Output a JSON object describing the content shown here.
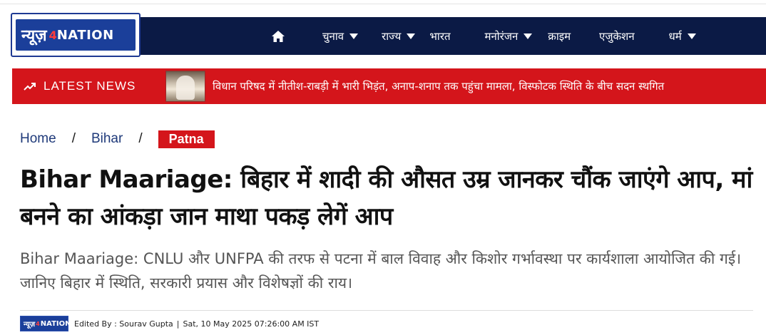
{
  "logo": {
    "hindi": "न्यूज़",
    "number": "4",
    "english": "NATION"
  },
  "nav": {
    "home_icon": "home-icon",
    "items": [
      {
        "label": "चुनाव",
        "dropdown": true
      },
      {
        "label": "राज्य",
        "dropdown": true
      },
      {
        "label": "भारत",
        "dropdown": false
      },
      {
        "label": "मनोरंजन",
        "dropdown": true
      },
      {
        "label": "क्राइम",
        "dropdown": false
      },
      {
        "label": "एजुकेशन",
        "dropdown": false
      },
      {
        "label": "धर्म",
        "dropdown": true
      }
    ]
  },
  "ticker": {
    "label": "LATEST NEWS",
    "icon": "trending-up-icon",
    "headline": "विधान परिषद में नीतीश-राबड़ी में भारी भिड़ंत, अनाप-शनाप तक पहुंचा मामला, विस्फोटक स्थिति के बीच सदन स्थगित"
  },
  "breadcrumb": {
    "home": "Home",
    "section": "Bihar",
    "current": "Patna",
    "separator": "/"
  },
  "article": {
    "headline": "Bihar Maariage: बिहार में शादी की औसत उम्र जानकर चौंक जाएंगे आप, मां बनने का आंकड़ा जान माथा पकड़ लेगें आप",
    "summary": "Bihar Maariage: CNLU और UNFPA की तरफ से पटना में बाल विवाह और किशोर गर्भावस्था पर कार्यशाला आयोजित की गई। जानिए बिहार में स्थिति, सरकारी प्रयास और विशेषज्ञों की राय।",
    "edited_by": "Edited By : Sourav Gupta",
    "separator": "|",
    "timestamp": "Sat, 10 May 2025 07:26:00 AM IST"
  },
  "colors": {
    "nav_bg": "#0b1a45",
    "accent_red": "#d4151b",
    "link_blue": "#1f3a7a"
  }
}
